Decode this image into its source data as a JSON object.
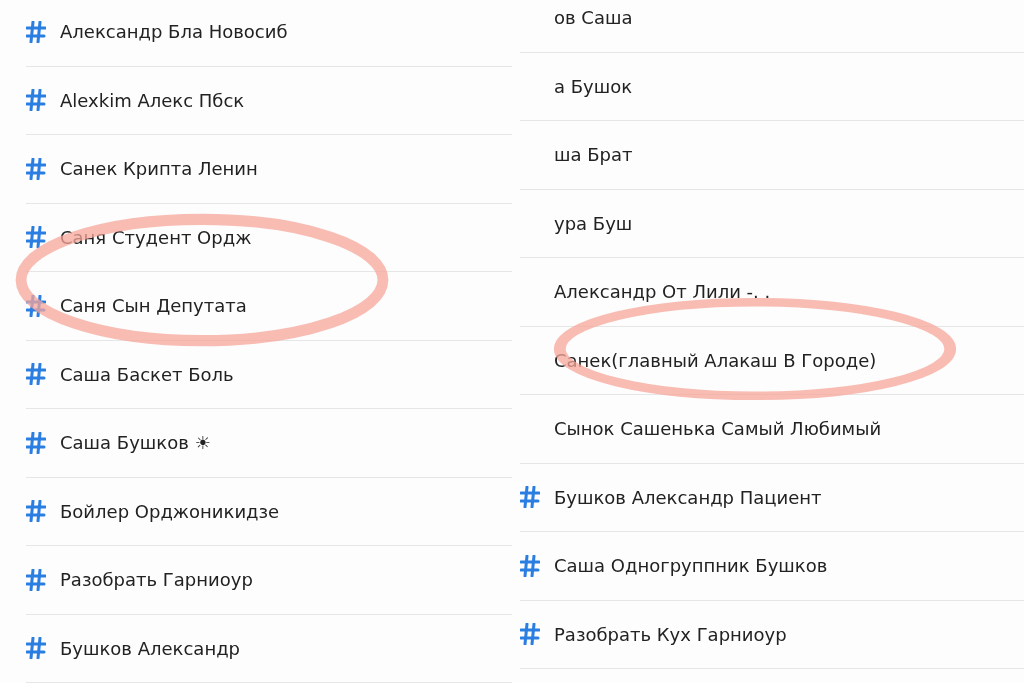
{
  "panels": [
    {
      "rows": [
        {
          "label": "Александр Бла Новосиб",
          "hash": true,
          "circled": false
        },
        {
          "label": "Alexkim Алекс Пбск",
          "hash": true,
          "circled": false
        },
        {
          "label": "Санек Крипта Ленин",
          "hash": true,
          "circled": false
        },
        {
          "label": "Саня Студент Ордж",
          "hash": true,
          "circled": false
        },
        {
          "label": "Саня Сын Депутата",
          "hash": true,
          "circled": true
        },
        {
          "label": "Саша Баскет Боль",
          "hash": true,
          "circled": false
        },
        {
          "label": "Саша Бушков ☀",
          "hash": true,
          "circled": false
        },
        {
          "label": "Бойлер Орджоникидзе",
          "hash": true,
          "circled": false
        },
        {
          "label": "Разобрать Гарниоур",
          "hash": true,
          "circled": false
        },
        {
          "label": "Бушков Александр",
          "hash": true,
          "circled": false
        }
      ]
    },
    {
      "rows": [
        {
          "label": "ов Саша",
          "hash": false,
          "circled": false
        },
        {
          "label": "а Бушок",
          "hash": false,
          "circled": false
        },
        {
          "label": "ша Брат",
          "hash": false,
          "circled": false
        },
        {
          "label": "ура Буш",
          "hash": false,
          "circled": false
        },
        {
          "label": "Александр От Лили -. .",
          "hash": false,
          "circled": false
        },
        {
          "label": "Санек(главный Алакаш В Городе)",
          "hash": false,
          "circled": true
        },
        {
          "label": "Сынок Сашенька Самый Любимый",
          "hash": false,
          "circled": false
        },
        {
          "label": "Бушков Александр Пациент",
          "hash": true,
          "circled": false
        },
        {
          "label": "Саша Одногруппник Бушков",
          "hash": true,
          "circled": false
        },
        {
          "label": "Разобрать Кух Гарниоур",
          "hash": true,
          "circled": false
        }
      ]
    }
  ]
}
